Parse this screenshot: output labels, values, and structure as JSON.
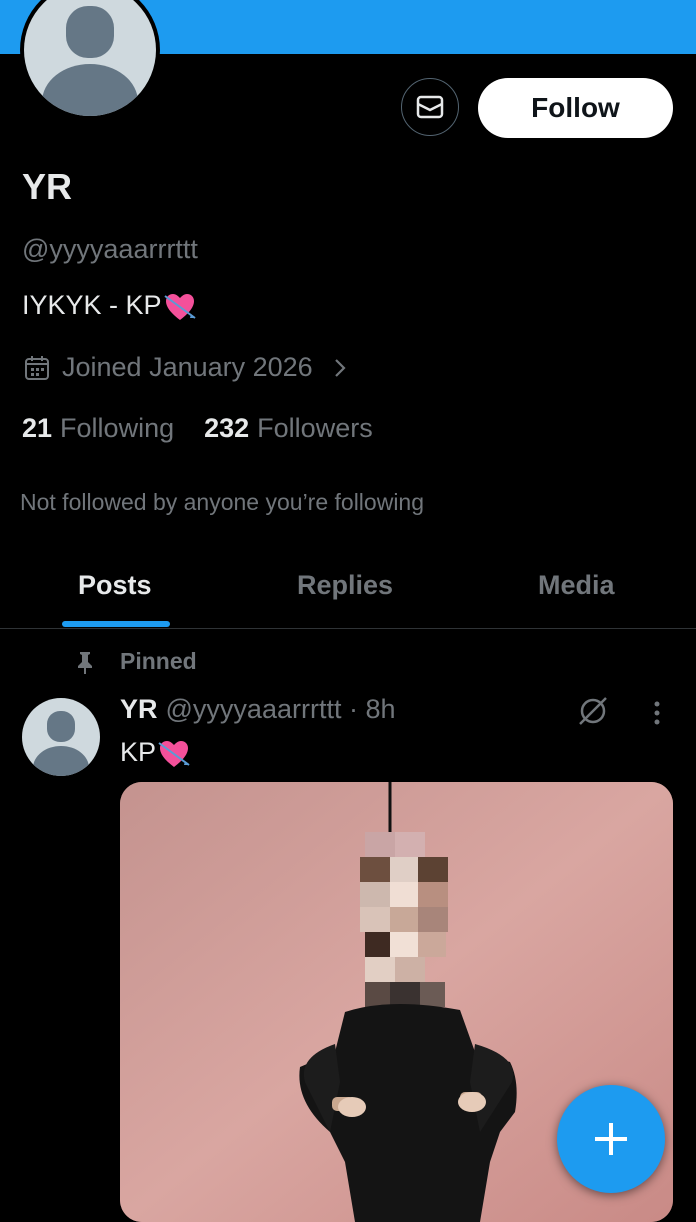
{
  "profile": {
    "name": "YR",
    "handle": "@yyyyaaarrrttt",
    "bio": "IYKYK - KP",
    "joined": "Joined January 2026",
    "following_count": "21",
    "following_label": "Following",
    "followers_count": "232",
    "followers_label": "Followers",
    "not_followed_text": "Not followed by anyone you’re following"
  },
  "actions": {
    "follow_label": "Follow"
  },
  "tabs": [
    {
      "label": "Posts"
    },
    {
      "label": "Replies"
    },
    {
      "label": "Media"
    }
  ],
  "post": {
    "pinned_label": "Pinned",
    "name": "YR",
    "handle_time": "@yyyyaaarrrttt · 8h",
    "text": "KP"
  },
  "colors": {
    "accent": "#1d9bf0",
    "background": "#000000",
    "muted": "#71767b"
  },
  "icons": [
    "mail-icon",
    "calendar-icon",
    "chevron-right-icon",
    "pin-icon",
    "grok-icon",
    "more-icon",
    "plus-icon",
    "heart-arrow-emoji"
  ]
}
